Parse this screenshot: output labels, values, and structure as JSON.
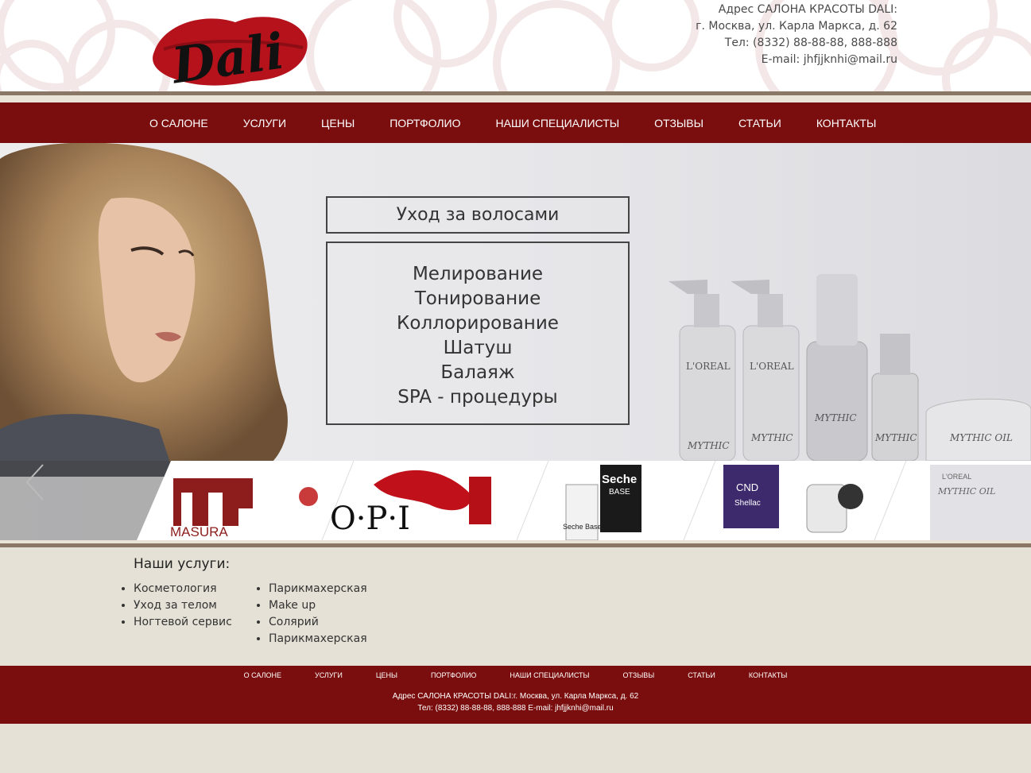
{
  "header": {
    "logo_text": "Dali",
    "address_title": "Адрес САЛОНА КРАСОТЫ DALI:",
    "address": "г. Москва, ул. Карла Маркса, д. 62",
    "phone": "Тел: (8332) 88-88-88, 888-888",
    "email": "E-mail: jhfjjknhi@mail.ru"
  },
  "nav": [
    "О САЛОНЕ",
    "УСЛУГИ",
    "ЦЕНЫ",
    "ПОРТФОЛИО",
    "НАШИ СПЕЦИАЛИСТЫ",
    "ОТЗЫВЫ",
    "СТАТЬИ",
    "КОНТАКТЫ"
  ],
  "slider": {
    "title": "Уход за волосами",
    "items": [
      "Мелирование",
      "Тонирование",
      "Коллорирование",
      "Шатуш",
      "Балаяж",
      "SPA - процедуры"
    ],
    "brands": [
      "MASURA",
      "O·P·I",
      "Seche",
      "BASE",
      "Seche Base",
      "CND",
      "Shellac",
      "L'OREAL",
      "MYTHIC OIL"
    ]
  },
  "services": {
    "title": "Наши услуги:",
    "col1": [
      "Косметология",
      "Уход за телом",
      "Ногтевой сервис"
    ],
    "col2": [
      "Парикмахерская",
      "Make up",
      "Солярий",
      "Парикмахерская"
    ]
  },
  "footer": {
    "nav": [
      "О САЛОНЕ",
      "УСЛУГИ",
      "ЦЕНЫ",
      "ПОРТФОЛИО",
      "НАШИ СПЕЦИАЛИСТЫ",
      "ОТЗЫВЫ",
      "СТАТЬИ",
      "КОНТАКТЫ"
    ],
    "address": "Адрес САЛОНА КРАСОТЫ DALI:г. Москва, ул. Карла Маркса, д. 62",
    "contacts": "Тел: (8332) 88-88-88, 888-888 E-mail: jhfjjknhi@mail.ru"
  },
  "colors": {
    "brand_red": "#7a0d0d",
    "brown_stripe": "#8a7766",
    "background": "#e6e1d6"
  }
}
